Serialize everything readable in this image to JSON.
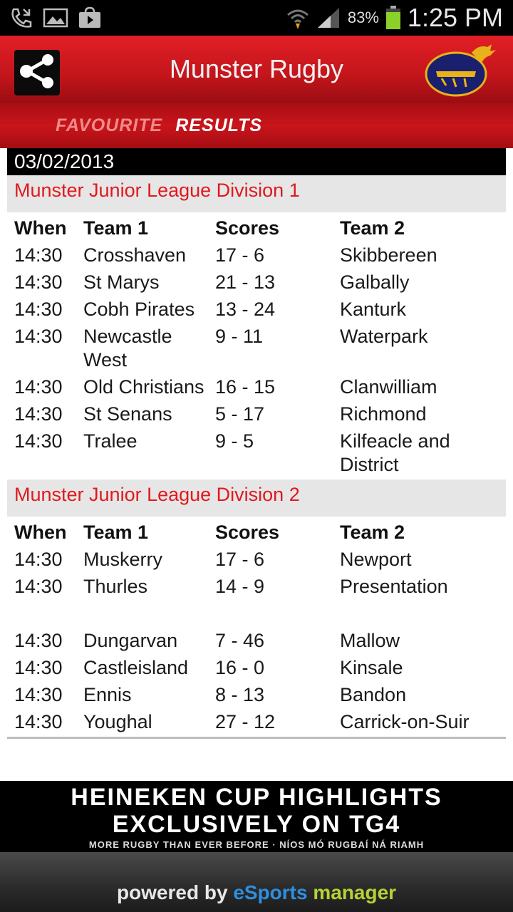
{
  "status_bar": {
    "battery_percent": "83%",
    "time": "1:25 PM",
    "icons": [
      "phone-missed-icon",
      "image-icon",
      "shopping-bag-icon",
      "wifi-icon",
      "signal-icon",
      "battery-icon"
    ]
  },
  "header": {
    "title": "Munster Rugby",
    "share_icon": "share-icon",
    "logo_icon": "munster-crest-icon"
  },
  "tabs": {
    "favourite": "FAVOURITE",
    "results": "RESULTS"
  },
  "results": {
    "date": "03/02/2013",
    "columns": {
      "when": "When",
      "team1": "Team 1",
      "scores": "Scores",
      "team2": "Team 2"
    },
    "leagues": [
      {
        "name": "Munster Junior League Division 1",
        "matches": [
          {
            "when": "14:30",
            "team1": "Crosshaven",
            "score": "17 - 6",
            "team2": "Skibbereen"
          },
          {
            "when": "14:30",
            "team1": "St Marys",
            "score": "21 - 13",
            "team2": "Galbally"
          },
          {
            "when": "14:30",
            "team1": "Cobh Pirates",
            "score": "13 - 24",
            "team2": "Kanturk"
          },
          {
            "when": "14:30",
            "team1": "Newcastle West",
            "score": "9 - 11",
            "team2": "Waterpark"
          },
          {
            "when": "14:30",
            "team1": "Old Christians",
            "score": "16 - 15",
            "team2": "Clanwilliam"
          },
          {
            "when": "14:30",
            "team1": "St Senans",
            "score": "5 - 17",
            "team2": "Richmond"
          },
          {
            "when": "14:30",
            "team1": "Tralee",
            "score": "9 - 5",
            "team2": "Kilfeacle and District"
          }
        ]
      },
      {
        "name": "Munster Junior League Division 2",
        "matches": [
          {
            "when": "14:30",
            "team1": "Muskerry",
            "score": "17 - 6",
            "team2": "Newport"
          },
          {
            "when": "14:30",
            "team1": "Thurles",
            "score": "14 - 9",
            "team2": "Presentation"
          },
          {
            "when": "14:30",
            "team1": "Dungarvan",
            "score": "7 - 46",
            "team2": "Mallow"
          },
          {
            "when": "14:30",
            "team1": "Castleisland",
            "score": "16 - 0",
            "team2": "Kinsale"
          },
          {
            "when": "14:30",
            "team1": "Ennis",
            "score": "8 - 13",
            "team2": "Bandon"
          },
          {
            "when": "14:30",
            "team1": "Youghal",
            "score": "27 - 12",
            "team2": "Carrick-on-Suir"
          }
        ]
      }
    ]
  },
  "banner": {
    "line1": "HEINEKEN CUP HIGHLIGHTS",
    "line2": "EXCLUSIVELY ON TG4",
    "line3": "MORE RUGBY THAN EVER BEFORE · NÍOS MÓ RUGBAÍ NÁ RIAMH"
  },
  "footer": {
    "powered": "powered by ",
    "brand_e": "eSports",
    "brand_space": " ",
    "brand_m": "manager"
  },
  "colors": {
    "accent_red": "#e0191e",
    "header_red": "#c2151b"
  }
}
